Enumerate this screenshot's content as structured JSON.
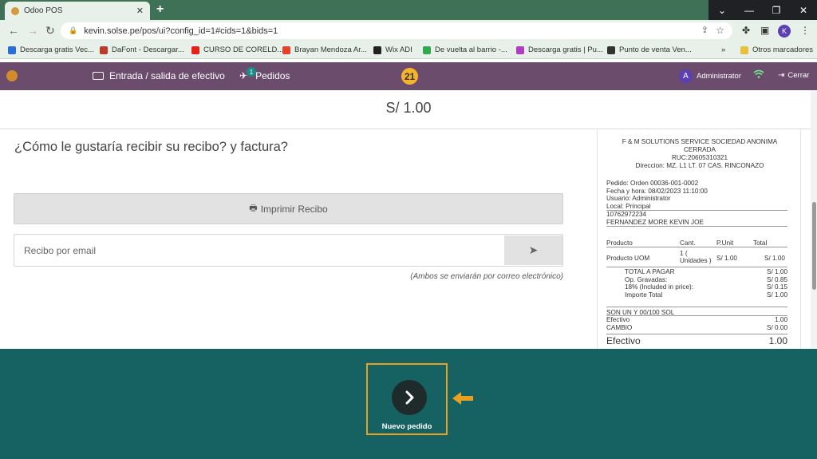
{
  "browser": {
    "tab_title": "Odoo POS",
    "tab_close": "✕",
    "new_tab": "+",
    "url": "kevin.solse.pe/pos/ui?config_id=1#cids=1&bids=1",
    "profile_initial": "K",
    "window_controls": [
      "⌄",
      "—",
      "❐",
      "✕"
    ],
    "bookmarks": [
      {
        "label": "Descarga gratis Vec...",
        "color": "#2a6fd6"
      },
      {
        "label": "DaFont - Descargar...",
        "color": "#c0392b"
      },
      {
        "label": "CURSO DE CORELD...",
        "color": "#e62117"
      },
      {
        "label": "Brayan Mendoza Ar...",
        "color": "#e2432a"
      },
      {
        "label": "Wix ADI",
        "color": "#222222"
      },
      {
        "label": "De vuelta al barrio -...",
        "color": "#2fa84f"
      },
      {
        "label": "Descarga gratis | Pu...",
        "color": "#b03cc4"
      },
      {
        "label": "Punto de venta Ven...",
        "color": "#333333"
      }
    ],
    "bookmarks_more": "»",
    "other_bookmarks": "Otros marcadores"
  },
  "pos_header": {
    "cash_label": "Entrada / salida de efectivo",
    "orders_label": "Pedidos",
    "orders_badge": "1",
    "sync_counter": "21",
    "user_initial": "A",
    "user_name": "Administrator",
    "logout_label": "Cerrar"
  },
  "payment": {
    "amount": "S/ 1.00",
    "question": "¿Cómo le gustaría recibir su recibo? y factura?",
    "print_label": "Imprimir Recibo",
    "email_placeholder": "Recibo por email",
    "email_note": "(Ambos se enviarán por correo electrónico)"
  },
  "receipt": {
    "company": [
      "F & M SOLUTIONS SERVICE SOCIEDAD ANONIMA",
      "CERRADA",
      "RUC:20605310321",
      "Direccion: MZ. L1 LT. 07 CAS. RINCONAZO"
    ],
    "order": "Pedido: Orden 00036-001-0002",
    "datetime": "Fecha y hora: 08/02/2023 11:10:00",
    "user": "Usuario: Administrator",
    "location": "Local: Principal",
    "client_doc": "10762972234",
    "client_name": "FERNANDEZ MORE KEVIN JOE",
    "headers": {
      "product": "Producto",
      "qty": "Cant.",
      "unit": "P.Unit",
      "total": "Total"
    },
    "line": {
      "product": "Producto UOM",
      "qty1": "1 (",
      "qty2": "Unidades )",
      "unit": "S/ 1.00",
      "total": "S/ 1.00"
    },
    "totals": [
      {
        "label": "TOTAL A PAGAR",
        "value": "S/ 1.00"
      },
      {
        "label": "Op. Gravadas:",
        "value": "S/ 0.85"
      },
      {
        "label": "18% (Included in price):",
        "value": "S/ 0.15"
      },
      {
        "label": "Importe Total",
        "value": "S/ 1.00"
      }
    ],
    "amount_words": "SON UN Y 00/100 SOL",
    "payments": [
      {
        "label": "Efectivo",
        "value": "1.00"
      },
      {
        "label": "CAMBIO",
        "value": "S/ 0.00"
      }
    ],
    "final": {
      "label": "Efectivo",
      "value": "1.00"
    }
  },
  "footer": {
    "new_order_label": "Nuevo pedido",
    "accent": "#e8a020"
  }
}
